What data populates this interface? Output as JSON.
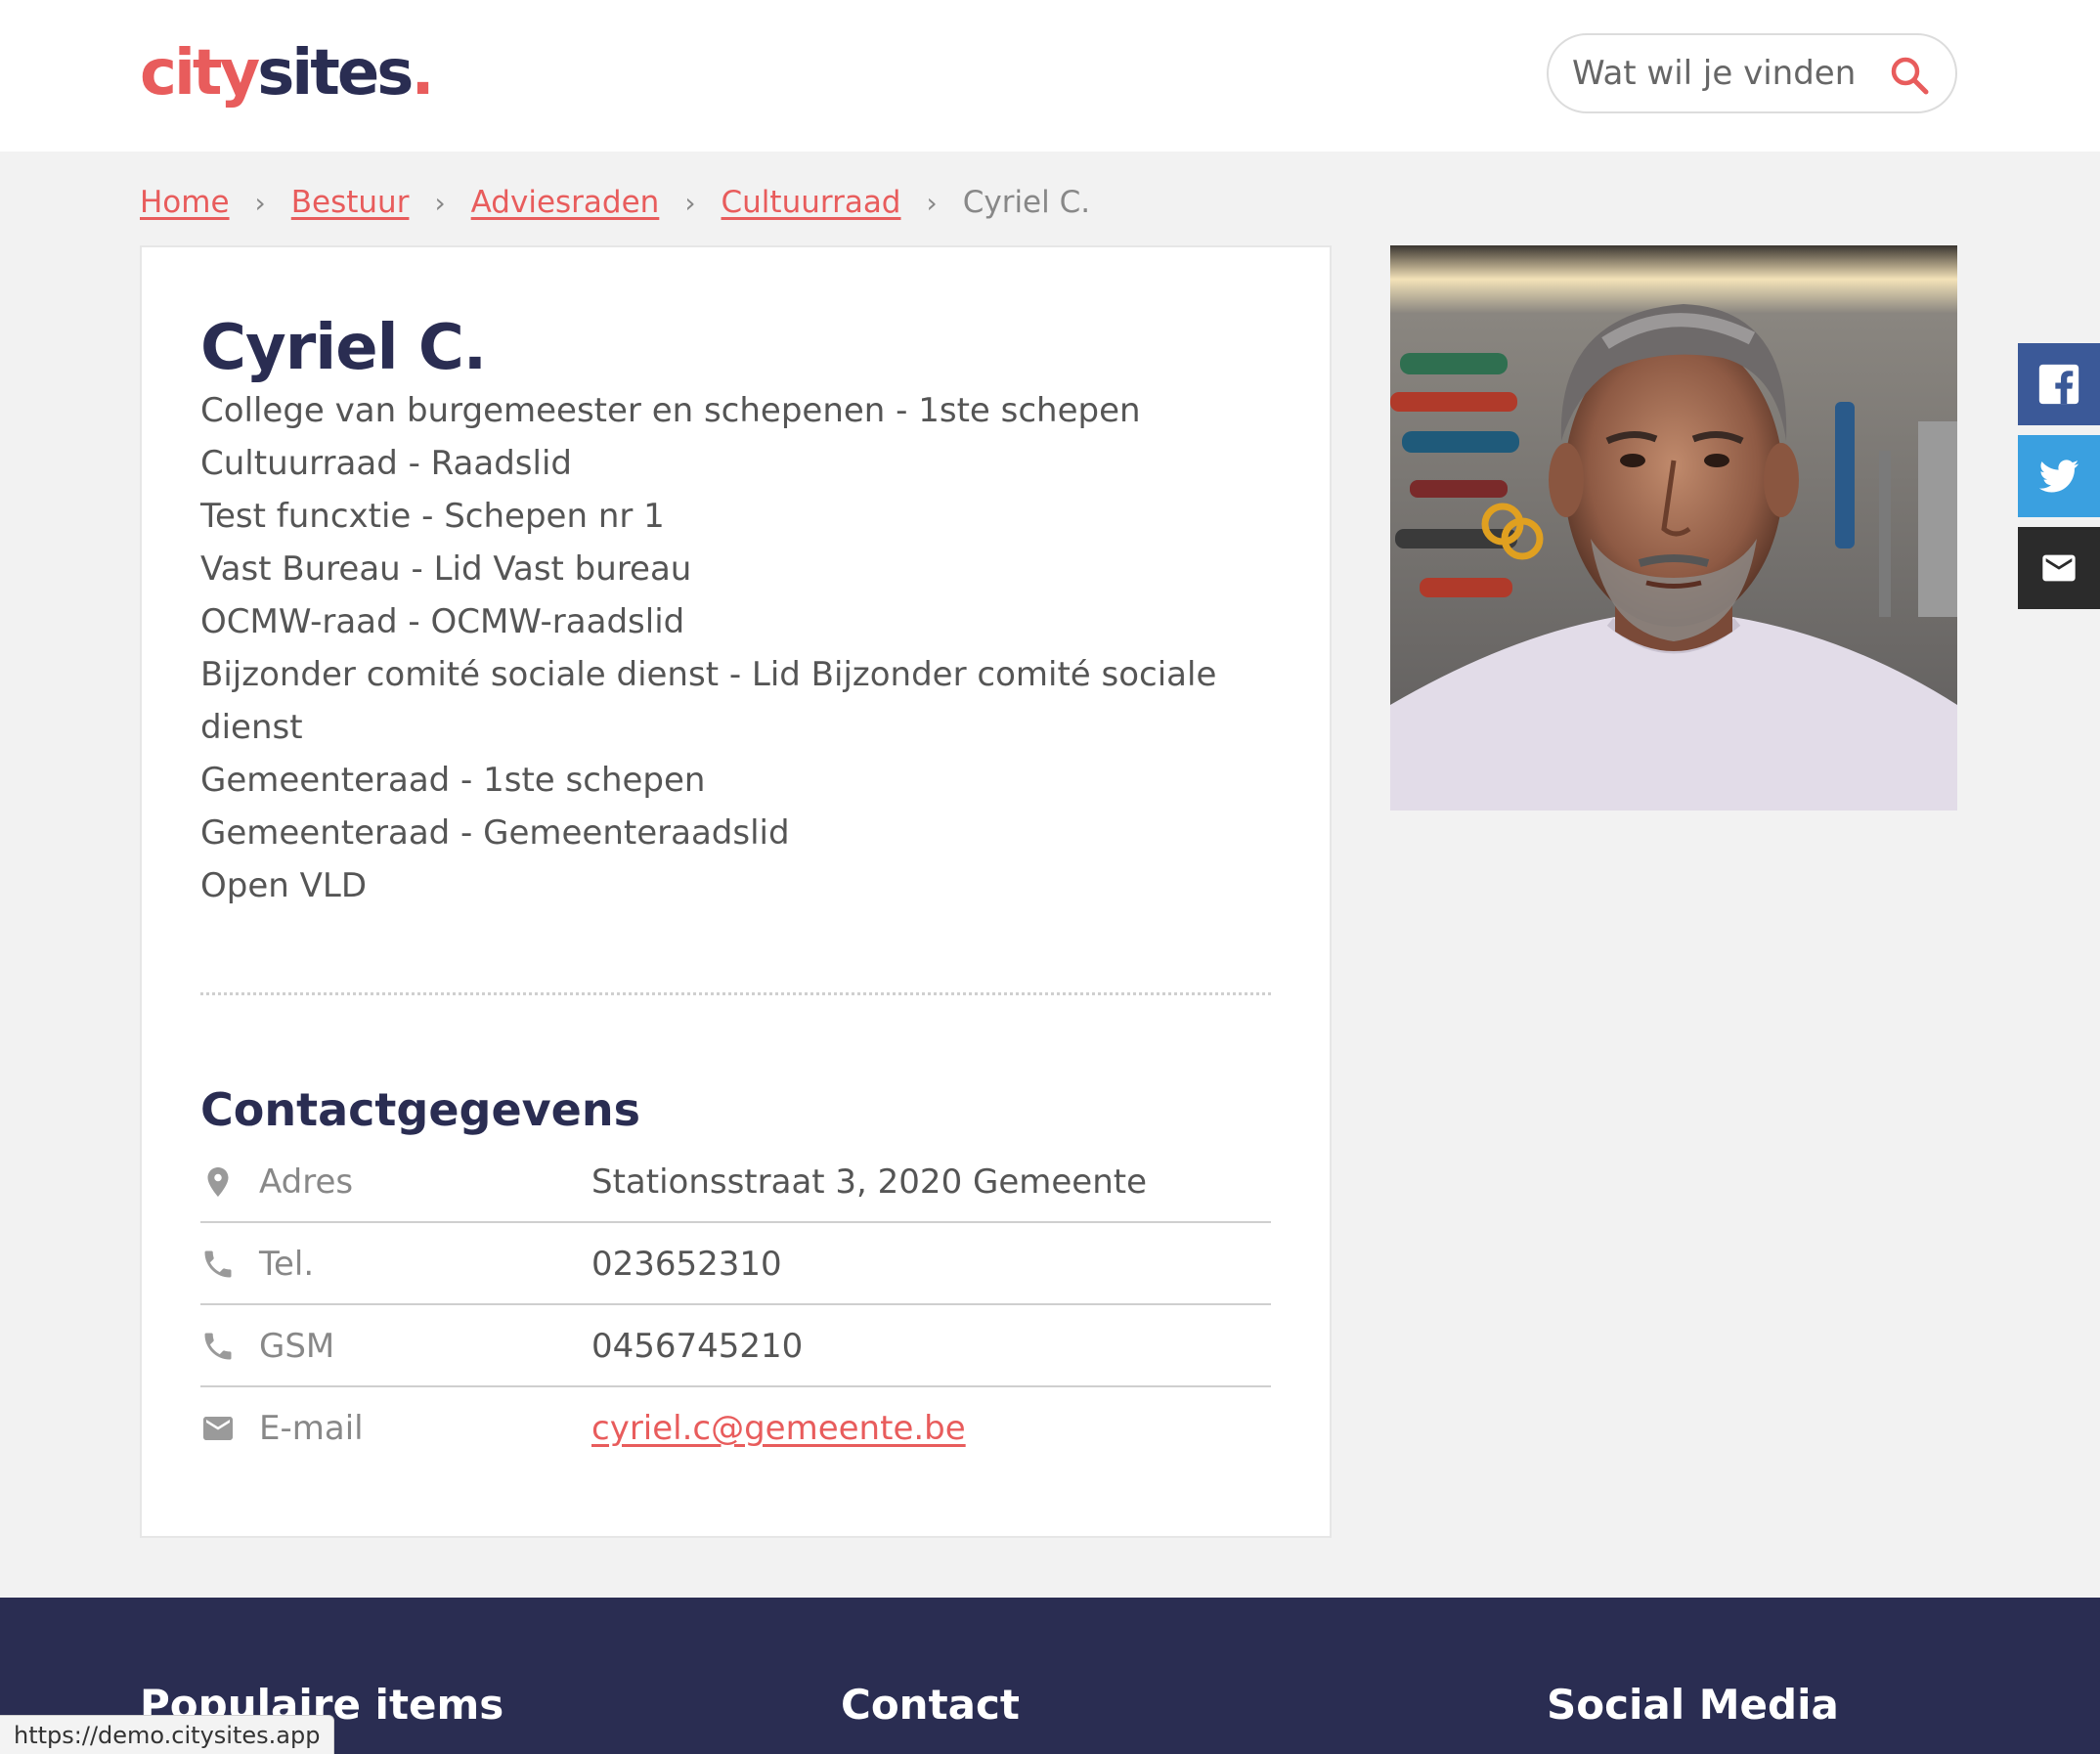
{
  "header": {
    "logo": {
      "part1": "city",
      "part2": "sites",
      "part3": "."
    },
    "search": {
      "placeholder": "Wat wil je vinden",
      "icon": "search-icon"
    }
  },
  "breadcrumb": {
    "items": [
      "Home",
      "Bestuur",
      "Adviesraden",
      "Cultuurraad"
    ],
    "separator": "›",
    "current": "Cyriel C."
  },
  "profile": {
    "name": "Cyriel C.",
    "roles": [
      "College van burgemeester en schepenen - 1ste schepen",
      "Cultuurraad - Raadslid",
      "Test funcxtie - Schepen nr 1",
      "Vast Bureau - Lid Vast bureau",
      "OCMW-raad - OCMW-raadslid",
      "Bijzonder comité sociale dienst - Lid Bijzonder comité sociale dienst",
      "Gemeenteraad - 1ste schepen",
      "Gemeenteraad - Gemeenteraadslid",
      "Open VLD"
    ]
  },
  "contact": {
    "title": "Contactgegevens",
    "rows": [
      {
        "icon": "location-pin-icon",
        "label": "Adres",
        "value": "Stationsstraat 3, 2020 Gemeente"
      },
      {
        "icon": "phone-icon",
        "label": "Tel.",
        "value": "023652310"
      },
      {
        "icon": "phone-icon",
        "label": "GSM",
        "value": "0456745210"
      },
      {
        "icon": "mail-icon",
        "label": "E-mail",
        "value": "cyriel.c@gemeente.be"
      }
    ]
  },
  "share": {
    "icons": [
      "facebook-icon",
      "twitter-icon",
      "mail-icon"
    ]
  },
  "footer": {
    "col1": "Populaire items",
    "col2": "Contact",
    "col3": "Social Media"
  },
  "status_url": "https://demo.citysites.app",
  "colors": {
    "accent": "#e85c5c",
    "navy": "#2a2d52",
    "facebook": "#3b5998",
    "twitter": "#3aa0e0"
  }
}
